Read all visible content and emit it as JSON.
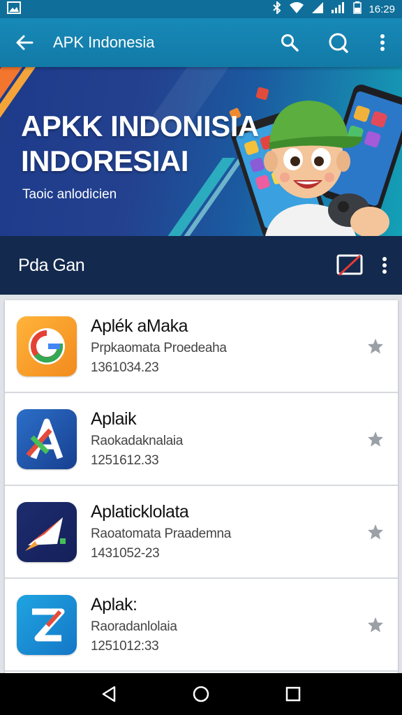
{
  "status_bar": {
    "time": "16:29",
    "icons": [
      "image-icon",
      "bluetooth-icon",
      "wifi-icon",
      "signal-icon",
      "signal-bars-icon",
      "battery-icon"
    ]
  },
  "app_bar": {
    "title": "APK Indonesia",
    "actions": [
      "back-arrow-icon",
      "search-icon",
      "chat-search-icon",
      "more-vert-icon"
    ]
  },
  "banner": {
    "title_line1": "APKK INDONISIA",
    "title_line2": "INDORESIAI",
    "subtitle": "Taoic anlodicien"
  },
  "section": {
    "title": "Pda Gan",
    "actions": [
      "cast-off-icon",
      "more-vert-icon"
    ]
  },
  "apps": [
    {
      "name": "Aplék aMaka",
      "description": "Prpkaomata Proedeaha",
      "meta": "1361034.23",
      "icon": "g-logo-icon"
    },
    {
      "name": "Aplaik",
      "description": "Raokadaknalaia",
      "meta": "1251612.33",
      "icon": "letter-a-icon"
    },
    {
      "name": "Aplaticklolata",
      "description": "Raoatomata Praademna",
      "meta": "1431052-23",
      "icon": "rocket-icon"
    },
    {
      "name": "Aplak:",
      "description": "Raoradanlolaia",
      "meta": "1251012:33",
      "icon": "z-logo-icon"
    }
  ],
  "nav_bar": [
    "back-triangle-icon",
    "home-circle-icon",
    "recents-square-icon"
  ],
  "colors": {
    "status_bar": "#0f6f9a",
    "app_bar": "#1789b8",
    "section_bar": "#13294d",
    "star": "#9aa0a6"
  }
}
